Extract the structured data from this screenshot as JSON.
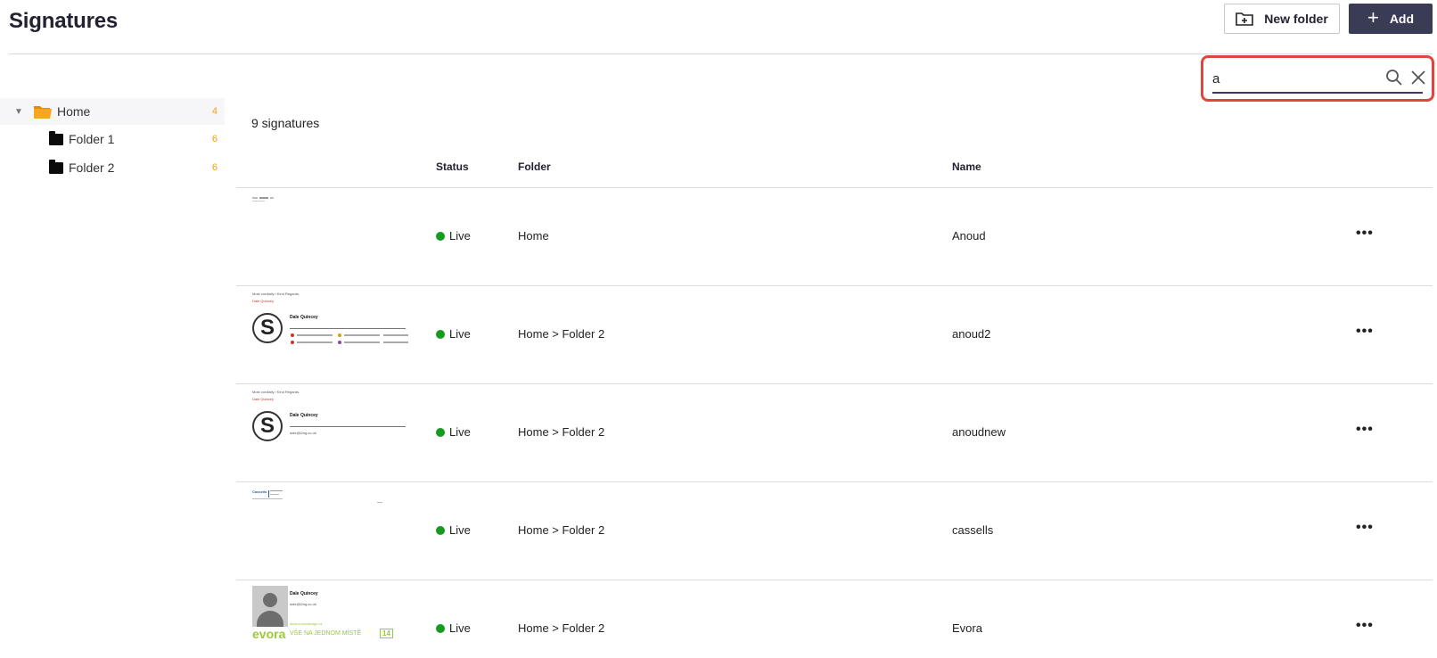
{
  "header": {
    "title": "Signatures",
    "new_folder_label": "New folder",
    "add_label": "Add"
  },
  "search": {
    "value": "a",
    "placeholder": ""
  },
  "sidebar": {
    "home": {
      "label": "Home",
      "count": "4"
    },
    "folders": [
      {
        "label": "Folder 1",
        "count": "6"
      },
      {
        "label": "Folder 2",
        "count": "6"
      }
    ]
  },
  "main": {
    "count_text": "9 signatures",
    "columns": {
      "status": "Status",
      "folder": "Folder",
      "name": "Name"
    },
    "rows": [
      {
        "status": "Live",
        "folder": "Home",
        "name": "Anoud",
        "more": "•••"
      },
      {
        "status": "Live",
        "folder": "Home > Folder 2",
        "name": "anoud2",
        "more": "•••"
      },
      {
        "status": "Live",
        "folder": "Home > Folder 2",
        "name": "anoudnew",
        "more": "•••"
      },
      {
        "status": "Live",
        "folder": "Home > Folder 2",
        "name": "cassells",
        "more": "•••"
      },
      {
        "status": "Live",
        "folder": "Home > Folder 2",
        "name": "Evora",
        "more": "•••"
      }
    ]
  },
  "thumbs": {
    "greeting": "Most cordially / Kind Regards,",
    "person": "Dale Quincey",
    "sig_name": "Dale Quincey",
    "email": "dale@i2ng.co.uk",
    "cassells_word": "Cassells",
    "website": "www.evoradesign.cz",
    "evora_brand": "evora",
    "evora_tagline": "VŠE NA JEDNOM MÍSTĚ",
    "evora_badge": "14"
  },
  "colors": {
    "accent": "#3a3b55",
    "live": "#159c1f",
    "highlight": "#e0463d",
    "count": "#f39c12"
  }
}
